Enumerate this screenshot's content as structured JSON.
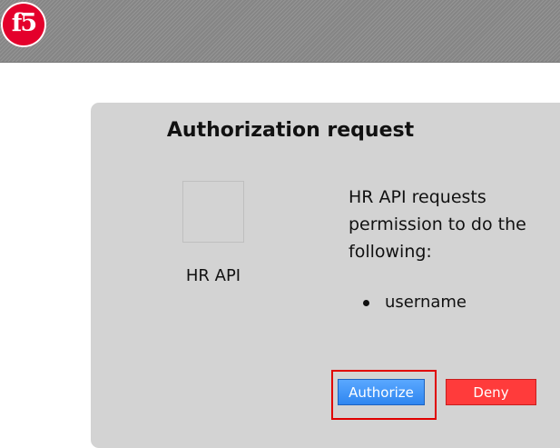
{
  "header": {
    "logo_text": "f5"
  },
  "dialog": {
    "title": "Authorization request",
    "app_name": "HR API",
    "request_text": "HR API requests permission to do the following:",
    "permissions": [
      {
        "label": "username"
      }
    ],
    "authorize_label": "Authorize",
    "deny_label": "Deny"
  },
  "colors": {
    "logo_red": "#e4002b",
    "authorize_blue": "#2f86f0",
    "deny_red": "#ff3b3b",
    "highlight_red": "#e00000"
  }
}
